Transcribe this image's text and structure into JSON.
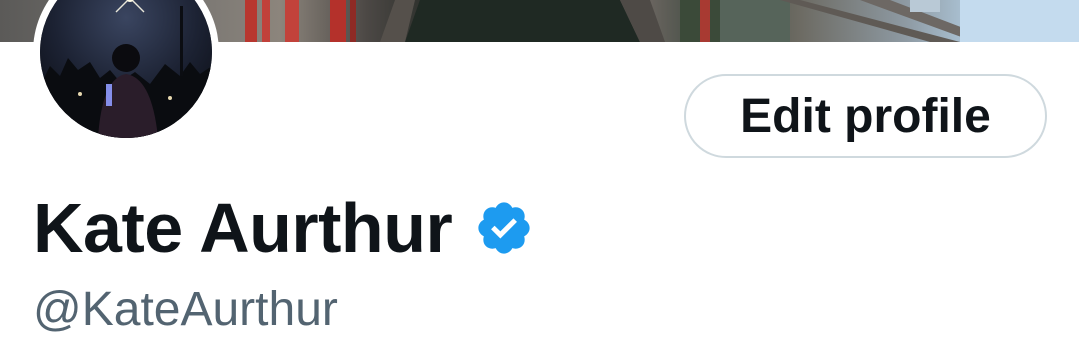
{
  "profile": {
    "display_name": "Kate Aurthur",
    "handle": "@KateAurthur",
    "verified": true,
    "edit_button_label": "Edit profile"
  },
  "icons": {
    "verified_badge": "verified-badge-icon"
  },
  "colors": {
    "text_primary": "#0f1419",
    "text_secondary": "#536471",
    "verified_blue": "#1d9bf0",
    "button_border": "#cfd9de"
  }
}
